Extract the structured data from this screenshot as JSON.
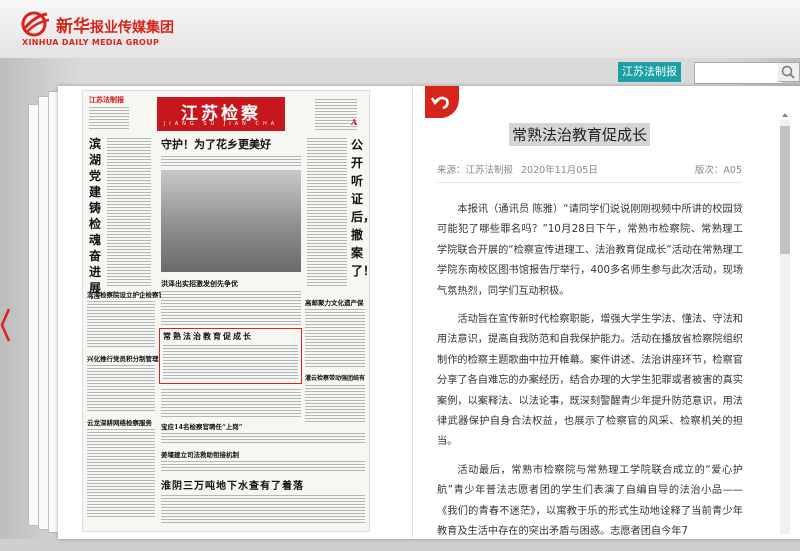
{
  "header": {
    "logo_cn": "新华",
    "logo_cn_rest": "报业传媒集团",
    "logo_en": "XINHUA DAILY MEDIA GROUP"
  },
  "toolbar": {
    "paper_button": "江苏法制报",
    "search_placeholder": ""
  },
  "newspaper": {
    "masthead": "江苏检察",
    "masthead_sub": "JIANG SU JIAN CHA",
    "brand": "江苏法制报",
    "headline": "守护！为了花乡更美好",
    "side_left": "滨湖党建铸检魂奋进展担当",
    "side_right": "公开听证后，撤案了！",
    "section_a": "A",
    "story1": "滨海检察院设立护企检察官",
    "story2": "洪泽出实招激发创先争优",
    "story3": "高邮聚力文化遗产保护",
    "story4": "兴化推行党员积分制管理",
    "story5": "云龙深耕网络检察服务",
    "story6": "常熟法治教育促成长",
    "story7": "灌云检察带动强团结有暑人",
    "story8": "宝应14名检察官聘任“上岗”",
    "story9": "姜堰建立司法救助衔接机制",
    "story10": "淮阴三万吨地下水查有了着落"
  },
  "article": {
    "title": "常熟法治教育促成长",
    "source": "来源：江苏法制报",
    "date": "2020年11月05日",
    "edition": "版次：A05",
    "paragraphs": [
      "本报讯（通讯员 陈雅）“请同学们说说刚刚视频中所讲的校园贷可能犯了哪些罪名吗？”10月28日下午，常熟市检察院、常熟理工学院联合开展的“检察宣传进理工、法治教育促成长”活动在常熟理工学院东南校区图书馆报告厅举行，400多名师生参与此次活动，现场气氛热烈，同学们互动积极。",
      "活动旨在宣传新时代检察职能，增强大学生学法、懂法、守法和用法意识，提高自我防范和自我保护能力。活动在播放省检察院组织制作的检察主题歌曲中拉开帷幕。案件讲述、法治讲座环节，检察官分享了各自难忘的办案经历，结合办理的大学生犯罪或者被害的真实案例，以案释法、以法论事，既深刻警醒青少年提升防范意识，用法律武器保护自身合法权益，也展示了检察官的风采、检察机关的担当。",
      "活动最后，常熟市检察院与常熟理工学院联合成立的“爱心护航”青少年普法志愿者团的学生们表演了自编自导的法治小品——《我们的青春不迷茫》，以寓教于乐的形式生动地诠释了当前青少年教育及生活中存在的突出矛盾与困惑。志愿者团自今年7"
    ]
  },
  "colors": {
    "accent": "#1aa1a3",
    "brand_red": "#d7251b",
    "masthead_red": "#c8161d"
  }
}
